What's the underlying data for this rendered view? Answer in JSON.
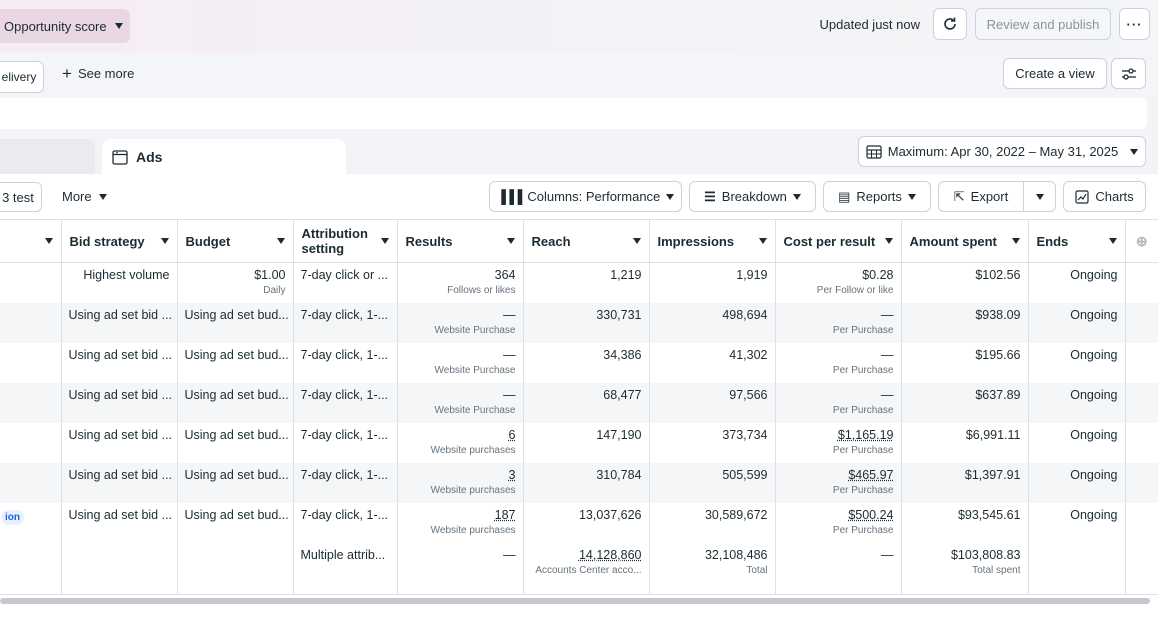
{
  "topbar": {
    "opportunity_label": "Opportunity score",
    "updated_text": "Updated just now",
    "review_label": "Review and publish",
    "more_label": "···"
  },
  "filters": {
    "delivery_label": "elivery",
    "see_more_label": "See more",
    "create_view_label": "Create a view"
  },
  "tabs": {
    "ads_label": "Ads"
  },
  "date_range": "Maximum: Apr 30, 2022 – May 31, 2025",
  "toolbar": {
    "test_label": "3 test",
    "more_label": "More",
    "columns_label": "Columns: Performance",
    "breakdown_label": "Breakdown",
    "reports_label": "Reports",
    "export_label": "Export",
    "charts_label": "Charts"
  },
  "columns": {
    "bid_strategy": "Bid strategy",
    "budget": "Budget",
    "attribution": "Attribution setting",
    "results": "Results",
    "reach": "Reach",
    "impressions": "Impressions",
    "cost_per_result": "Cost per result",
    "amount_spent": "Amount spent",
    "ends": "Ends"
  },
  "rows": [
    {
      "pill": "",
      "bid": "Highest volume",
      "budget": "$1.00",
      "budget_sub": "Daily",
      "attr": "7-day click or ...",
      "results": "364",
      "results_sub": "Follows or likes",
      "reach": "1,219",
      "impressions": "1,919",
      "cpr": "$0.28",
      "cpr_sub": "Per Follow or like",
      "spent": "$102.56",
      "ends": "Ongoing"
    },
    {
      "pill": "",
      "bid": "Using ad set bid ...",
      "budget": "Using ad set bud...",
      "budget_sub": "",
      "attr": "7-day click, 1-...",
      "results": "—",
      "results_sub": "Website Purchase",
      "reach": "330,731",
      "impressions": "498,694",
      "cpr": "—",
      "cpr_sub": "Per Purchase",
      "spent": "$938.09",
      "ends": "Ongoing"
    },
    {
      "pill": "",
      "bid": "Using ad set bid ...",
      "budget": "Using ad set bud...",
      "budget_sub": "",
      "attr": "7-day click, 1-...",
      "results": "—",
      "results_sub": "Website Purchase",
      "reach": "34,386",
      "impressions": "41,302",
      "cpr": "—",
      "cpr_sub": "Per Purchase",
      "spent": "$195.66",
      "ends": "Ongoing"
    },
    {
      "pill": "",
      "bid": "Using ad set bid ...",
      "budget": "Using ad set bud...",
      "budget_sub": "",
      "attr": "7-day click, 1-...",
      "results": "—",
      "results_sub": "Website Purchase",
      "reach": "68,477",
      "impressions": "97,566",
      "cpr": "—",
      "cpr_sub": "Per Purchase",
      "spent": "$637.89",
      "ends": "Ongoing"
    },
    {
      "pill": "",
      "bid": "Using ad set bid ...",
      "budget": "Using ad set bud...",
      "budget_sub": "",
      "attr": "7-day click, 1-...",
      "results": "6",
      "results_sub": "Website purchases",
      "reach": "147,190",
      "impressions": "373,734",
      "cpr": "$1,165.19",
      "cpr_sub": "Per Purchase",
      "spent": "$6,991.11",
      "ends": "Ongoing"
    },
    {
      "pill": "",
      "bid": "Using ad set bid ...",
      "budget": "Using ad set bud...",
      "budget_sub": "",
      "attr": "7-day click, 1-...",
      "results": "3",
      "results_sub": "Website purchases",
      "reach": "310,784",
      "impressions": "505,599",
      "cpr": "$465.97",
      "cpr_sub": "Per Purchase",
      "spent": "$1,397.91",
      "ends": "Ongoing"
    },
    {
      "pill": "ion",
      "bid": "Using ad set bid ...",
      "budget": "Using ad set bud...",
      "budget_sub": "",
      "attr": "7-day click, 1-...",
      "results": "187",
      "results_sub": "Website purchases",
      "reach": "13,037,626",
      "impressions": "30,589,672",
      "cpr": "$500.24",
      "cpr_sub": "Per Purchase",
      "spent": "$93,545.61",
      "ends": "Ongoing"
    }
  ],
  "totals": {
    "attr": "Multiple attrib...",
    "results": "—",
    "reach": "14,128,860",
    "reach_sub": "Accounts Center acco...",
    "impressions": "32,108,486",
    "impressions_sub": "Total",
    "cpr": "—",
    "spent": "$103,808.83",
    "spent_sub": "Total spent"
  }
}
